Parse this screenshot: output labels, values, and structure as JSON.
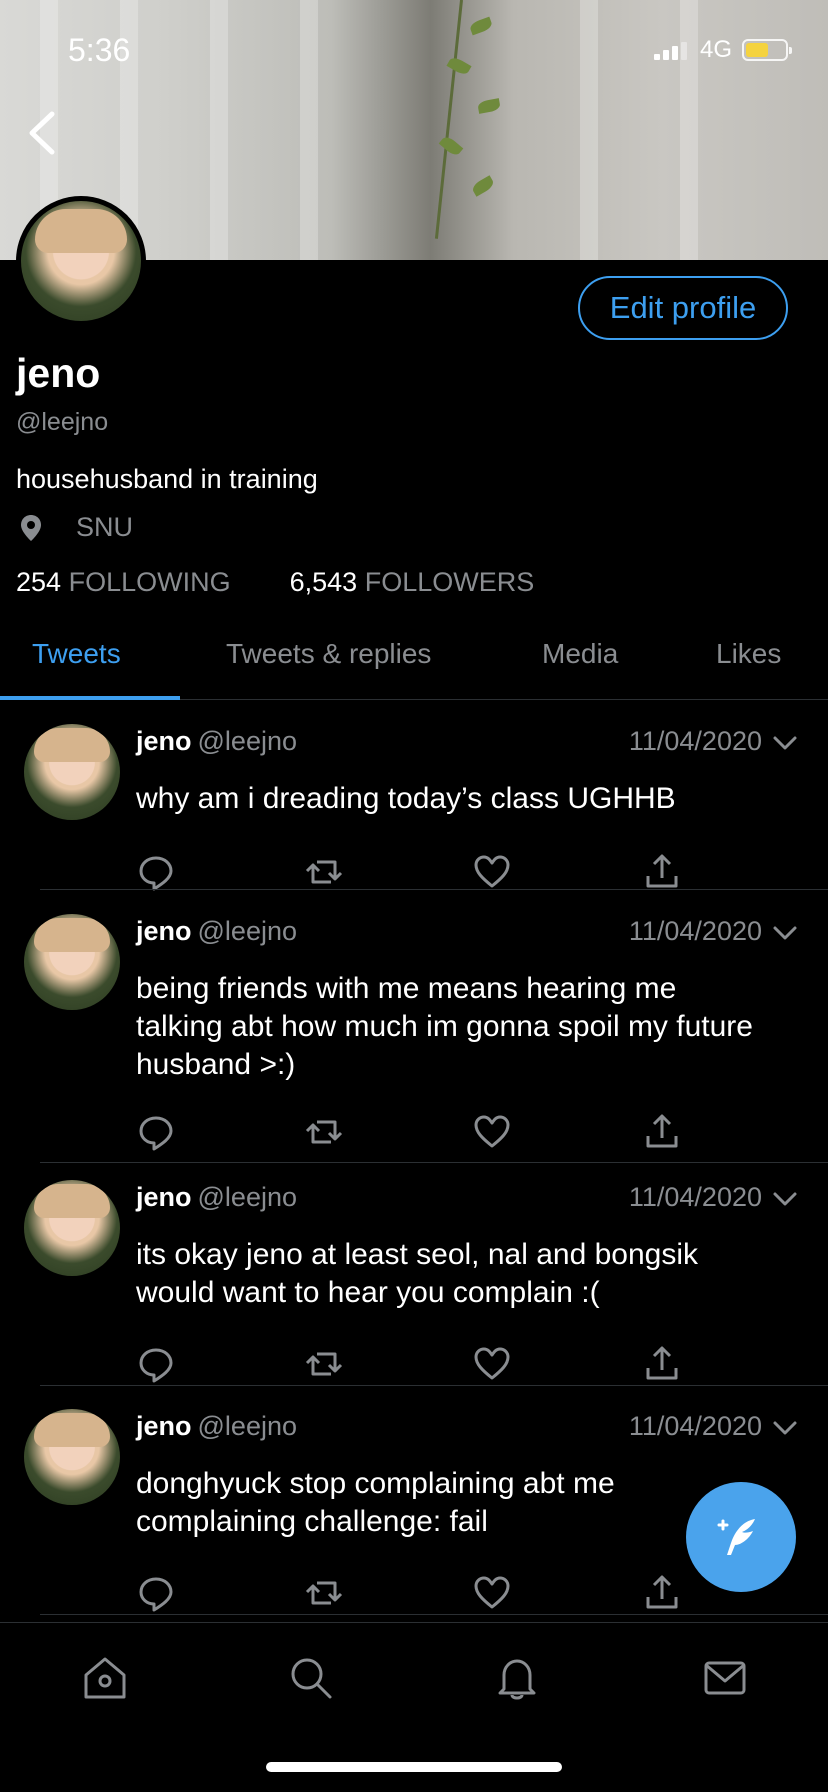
{
  "status_bar": {
    "time": "5:36",
    "network": "4G",
    "battery_level": 0.5,
    "battery_color": "#f5d33f"
  },
  "header": {
    "back_icon": "chevron-left-icon"
  },
  "profile": {
    "name": "jeno",
    "handle": "@leejno",
    "bio": "househusband in training",
    "location_icon": "location-pin-icon",
    "location": "SNU",
    "following_count": "254",
    "following_label": "FOLLOWING",
    "followers_count": "6,543",
    "followers_label": "FOLLOWERS",
    "edit_label": "Edit profile"
  },
  "tabs": [
    {
      "label": "Tweets",
      "active": true
    },
    {
      "label": "Tweets & replies",
      "active": false
    },
    {
      "label": "Media",
      "active": false
    },
    {
      "label": "Likes",
      "active": false
    }
  ],
  "tweets": [
    {
      "name": "jeno",
      "handle": "@leejno",
      "date": "11/04/2020",
      "text": "why am i dreading today’s class UGHHB"
    },
    {
      "name": "jeno",
      "handle": "@leejno",
      "date": "11/04/2020",
      "text": "being friends with me means hearing me talking abt how much im gonna spoil my future husband >:)"
    },
    {
      "name": "jeno",
      "handle": "@leejno",
      "date": "11/04/2020",
      "text": "its okay jeno at least seol, nal and bongsik would want to hear you complain :("
    },
    {
      "name": "jeno",
      "handle": "@leejno",
      "date": "11/04/2020",
      "text": "donghyuck stop complaining abt me complaining challenge: fail"
    }
  ],
  "tweet_actions": [
    "reply-icon",
    "retweet-icon",
    "like-icon",
    "share-icon"
  ],
  "fab_icon": "compose-tweet-icon",
  "bottom_nav": [
    "home-icon",
    "search-icon",
    "notifications-icon",
    "messages-icon"
  ],
  "colors": {
    "accent": "#3d9ff0",
    "background": "#000000",
    "muted": "#8a8d91",
    "fab": "#4aa3ec"
  }
}
